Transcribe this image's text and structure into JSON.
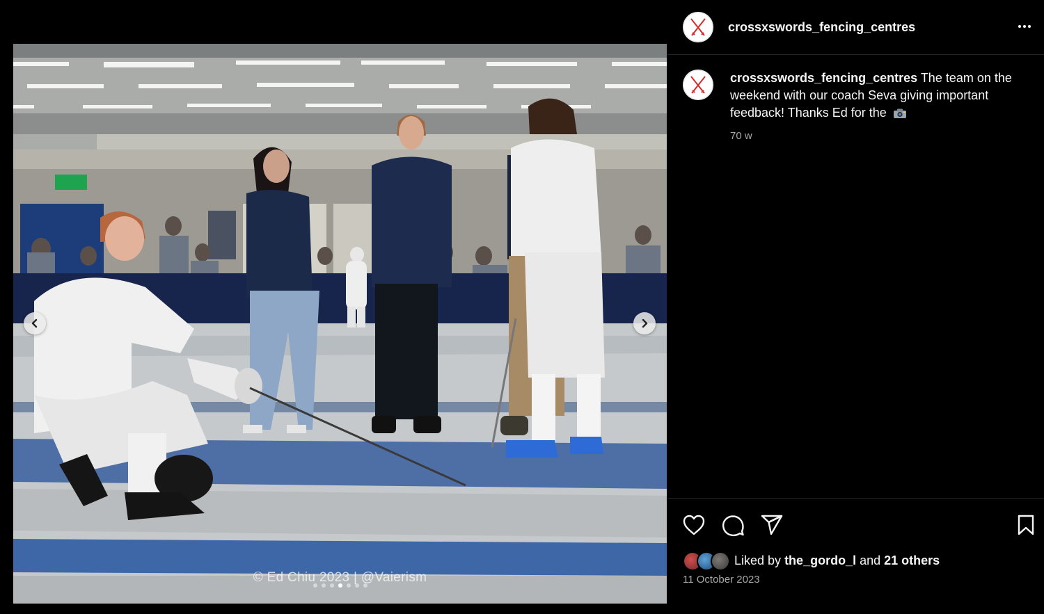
{
  "post": {
    "username": "crossxswords_fencing_centres",
    "caption": "The team on the weekend with our coach Seva giving important feedback! Thanks Ed for the",
    "caption_emoji": "camera-icon",
    "time_ago": "70 w",
    "watermark": "© Ed Chiu 2023 | @Vaierism",
    "carousel": {
      "count": 7,
      "active_index": 3
    },
    "likes": {
      "prefix": "Liked by",
      "user": "the_gordo_l",
      "and": "and",
      "others": "21 others"
    },
    "date": "11 October 2023"
  },
  "icons": {
    "like": "heart-icon",
    "comment": "comment-icon",
    "share": "send-icon",
    "save": "bookmark-icon",
    "more": "more-icon",
    "prev": "chevron-left-icon",
    "next": "chevron-right-icon"
  },
  "colors": {
    "background": "#000000",
    "text": "#f5f5f5",
    "secondary_text": "#a8a8a8",
    "divider": "#262626",
    "brand_red": "#d62b2b"
  }
}
